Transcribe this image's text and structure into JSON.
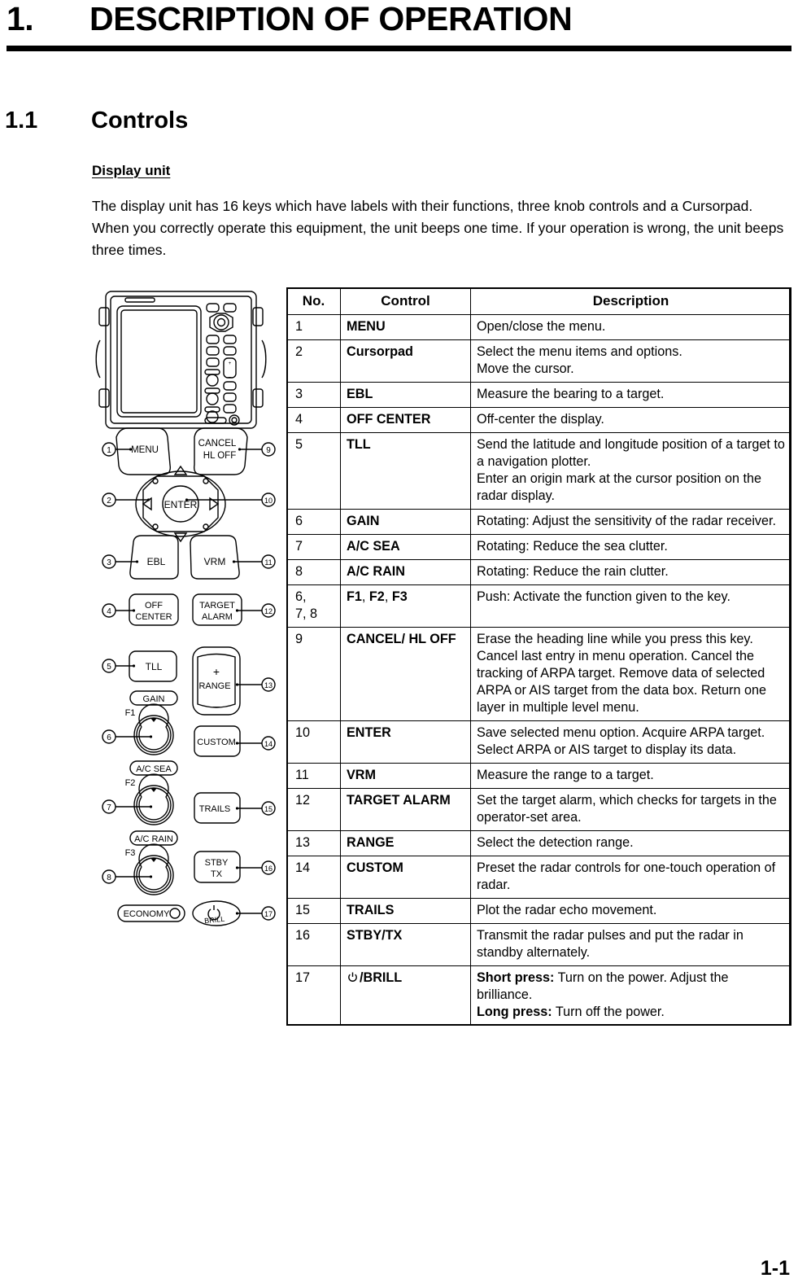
{
  "chapter": {
    "number": "1.",
    "title": "DESCRIPTION OF OPERATION"
  },
  "section": {
    "number": "1.1",
    "title": "Controls"
  },
  "subheading": "Display unit",
  "paragraph": "The display unit has 16 keys which have labels with their functions, three knob controls and a Cursorpad. When you correctly operate this equipment, the unit beeps one time. If your operation is wrong, the unit beeps three times.",
  "table": {
    "headers": {
      "no": "No.",
      "control": "Control",
      "description": "Description"
    },
    "rows": [
      {
        "no": "1",
        "control": "MENU",
        "description": "Open/close the menu."
      },
      {
        "no": "2",
        "control": "Cursorpad",
        "description": "Select the menu items and options.\nMove the cursor."
      },
      {
        "no": "3",
        "control": "EBL",
        "description": "Measure the bearing to a target."
      },
      {
        "no": "4",
        "control": "OFF CENTER",
        "description": "Off-center the display."
      },
      {
        "no": "5",
        "control": "TLL",
        "description": "Send the latitude and longitude position of a target to a navigation plotter.\nEnter an origin mark at the cursor position on the radar display."
      },
      {
        "no": "6",
        "control": "GAIN",
        "description": "Rotating: Adjust the sensitivity of the radar receiver."
      },
      {
        "no": "7",
        "control": "A/C SEA",
        "description": "Rotating: Reduce the sea clutter."
      },
      {
        "no": "8",
        "control": "A/C RAIN",
        "description": "Rotating: Reduce the rain clutter."
      },
      {
        "no": "6,\n7, 8",
        "control": "F1, F2, F3",
        "description": "Push: Activate the function given to the key."
      },
      {
        "no": "9",
        "control": "CANCEL/ HL OFF",
        "description": "Erase the heading line while you press this key. Cancel last entry in menu operation. Cancel the tracking of ARPA target. Remove data of selected ARPA or AIS target from the data box. Return one layer in multiple level menu."
      },
      {
        "no": "10",
        "control": "ENTER",
        "description": "Save selected menu option. Acquire ARPA target. Select ARPA or AIS target to display its data."
      },
      {
        "no": "11",
        "control": "VRM",
        "description": "Measure the range to a target."
      },
      {
        "no": "12",
        "control": "TARGET ALARM",
        "description": "Set the target alarm, which checks for targets in the operator-set area."
      },
      {
        "no": "13",
        "control": "RANGE",
        "description": "Select the detection range."
      },
      {
        "no": "14",
        "control": "CUSTOM",
        "description": "Preset the radar controls for one-touch operation of radar."
      },
      {
        "no": "15",
        "control": "TRAILS",
        "description": "Plot the radar echo movement."
      },
      {
        "no": "16",
        "control": "STBY/TX",
        "description": "Transmit the radar pulses and put the radar in standby alternately."
      },
      {
        "no": "17",
        "control": "/BRILL",
        "control_icon": "power-icon",
        "description_parts": [
          {
            "bold": "Short press:",
            "text": " Turn on the power. Adjust the brilliance."
          },
          {
            "bold": "Long press:",
            "text": " Turn off the power."
          }
        ]
      }
    ]
  },
  "illustration": {
    "name": "radar-display-unit-control-callouts",
    "keys": [
      {
        "callout": "1",
        "label": "MENU"
      },
      {
        "callout": "2",
        "label": "Cursorpad"
      },
      {
        "callout": "3",
        "label": "EBL"
      },
      {
        "callout": "4",
        "label": "OFF CENTER"
      },
      {
        "callout": "5",
        "label": "TLL"
      },
      {
        "callout": "6",
        "label": "F1"
      },
      {
        "callout": "7",
        "label": "F2"
      },
      {
        "callout": "8",
        "label": "F3"
      },
      {
        "callout": "9",
        "label": "CANCEL HL OFF"
      },
      {
        "callout": "10",
        "label": "ENTER"
      },
      {
        "callout": "11",
        "label": "VRM"
      },
      {
        "callout": "12",
        "label": "TARGET ALARM"
      },
      {
        "callout": "13",
        "label": "RANGE"
      },
      {
        "callout": "14",
        "label": "CUSTOM"
      },
      {
        "callout": "15",
        "label": "TRAILS"
      },
      {
        "callout": "16",
        "label": "STBY TX"
      },
      {
        "callout": "17",
        "label": "BRILL"
      }
    ],
    "knob_labels": [
      "GAIN",
      "A/C SEA",
      "A/C RAIN",
      "ECONOMY"
    ],
    "range_plus": "+",
    "range_minus": "_"
  },
  "footer": {
    "page": "1-1"
  }
}
